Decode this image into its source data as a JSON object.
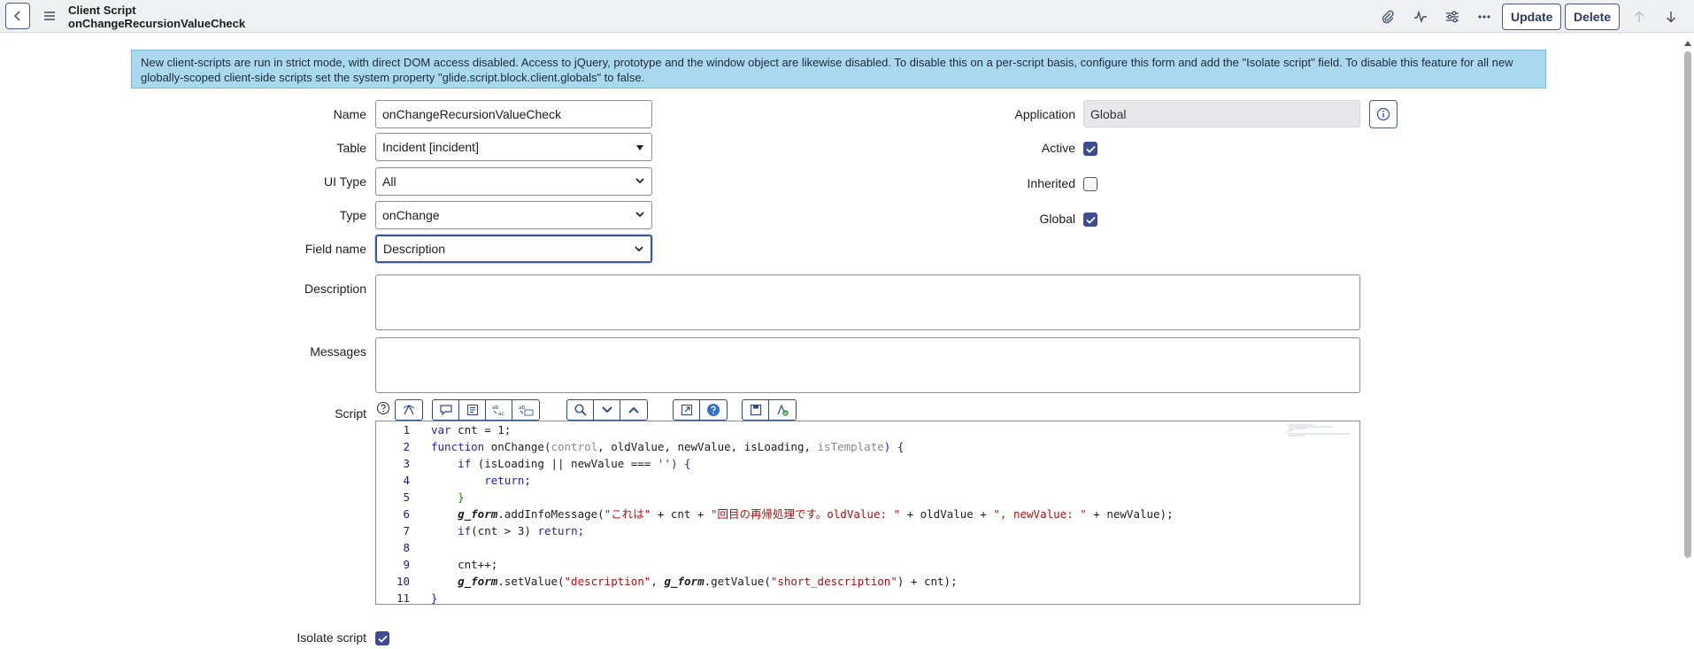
{
  "header": {
    "title": "Client Script",
    "subtitle": "onChangeRecursionValueCheck",
    "update_label": "Update",
    "delete_label": "Delete",
    "icons": [
      "back-icon",
      "menu-icon",
      "attachment-icon",
      "activity-icon",
      "settings-sliders-icon",
      "more-icon",
      "arrow-up-icon",
      "arrow-down-icon"
    ]
  },
  "banner": {
    "text": "New client-scripts are run in strict mode, with direct DOM access disabled. Access to jQuery, prototype and the window object are likewise disabled. To disable this on a per-script basis, configure this form and add the \"Isolate script\" field. To disable this feature for all new globally-scoped client-side scripts set the system property \"glide.script.block.client.globals\" to false."
  },
  "form": {
    "name": {
      "label": "Name",
      "value": "onChangeRecursionValueCheck"
    },
    "table": {
      "label": "Table",
      "value": "Incident [incident]"
    },
    "ui_type": {
      "label": "UI Type",
      "value": "All"
    },
    "type": {
      "label": "Type",
      "value": "onChange"
    },
    "field_name": {
      "label": "Field name",
      "value": "Description"
    },
    "description": {
      "label": "Description",
      "value": ""
    },
    "messages": {
      "label": "Messages",
      "value": ""
    },
    "application": {
      "label": "Application",
      "value": "Global"
    },
    "active": {
      "label": "Active",
      "checked": true
    },
    "inherited": {
      "label": "Inherited",
      "checked": false
    },
    "global": {
      "label": "Global",
      "checked": true
    },
    "script_label": "Script",
    "isolate_script": {
      "label": "Isolate script",
      "checked": true
    }
  },
  "script_toolbar": {
    "groups": [
      [
        "script-format-icon"
      ],
      [
        "comment-icon",
        "format-code-icon",
        "replace-icon",
        "replace-all-icon"
      ],
      [
        "search-icon",
        "fold-down-icon",
        "fold-up-icon"
      ],
      [
        "fullscreen-icon",
        "help-icon"
      ],
      [
        "save-icon",
        "script-debug-icon"
      ]
    ]
  },
  "code": {
    "line_numbers": [
      "1",
      "2",
      "3",
      "4",
      "5",
      "6",
      "7",
      "8",
      "9",
      "10",
      "11"
    ],
    "l1": {
      "kw": "var",
      "rest": " cnt = 1;"
    },
    "l2": {
      "kw": "function",
      "name": " onChange",
      "open": "(",
      "p1": "control",
      "p2": ", oldValue, newValue, isLoading, ",
      "p3": "isTemplate",
      "close": ") {"
    },
    "l3": {
      "kw": "if",
      "cond": " (isLoading || newValue === ",
      "str": "''",
      "close": ") {"
    },
    "l4": {
      "kw": "return",
      "rest": ";"
    },
    "l5": {
      "brace": "}"
    },
    "l6": {
      "obj": "g_form",
      "m": ".addInfoMessage(",
      "s1": "\"これは\"",
      "a1": " + cnt + ",
      "s2": "\"回目の再帰処理です。oldValue: \"",
      "a2": " + oldValue + ",
      "s3": "\", newValue: \"",
      "a3": " + newValue);"
    },
    "l7": {
      "kw": "if",
      "cond": "(cnt > 3) ",
      "kw2": "return",
      "rest": ";"
    },
    "l8": {
      "text": ""
    },
    "l9": {
      "text": "cnt++;"
    },
    "l10": {
      "obj1": "g_form",
      "m1": ".setValue(",
      "s1": "\"description\"",
      "c": ", ",
      "obj2": "g_form",
      "m2": ".getValue(",
      "s2": "\"short_description\"",
      "rest": ") + cnt);"
    },
    "l11": {
      "brace": "}"
    }
  },
  "colors": {
    "primary": "#3c4d96",
    "banner": "#a9d8ef",
    "keyword": "#1f1fb8",
    "string": "#aa1111"
  }
}
